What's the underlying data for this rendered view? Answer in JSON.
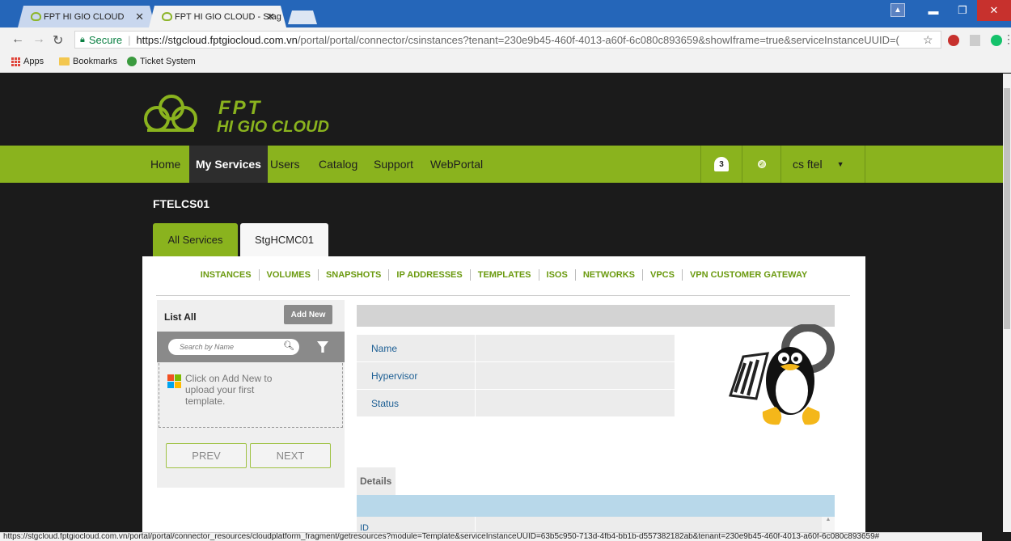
{
  "browser": {
    "tabs": [
      {
        "title": "FPT HI GIO CLOUD",
        "active": false
      },
      {
        "title": "FPT HI GIO CLOUD - Stag",
        "active": true
      }
    ],
    "secure_label": "Secure",
    "url_host": "https://stgcloud.fptgiocloud.com.vn",
    "url_path": "/portal/portal/connector/csinstances?tenant=230e9b45-460f-4013-a60f-6c080c893659&showIframe=true&serviceInstanceUUID=(",
    "bookmarks": [
      "Apps",
      "Bookmarks",
      "Ticket System"
    ],
    "status_url": "https://stgcloud.fptgiocloud.com.vn/portal/portal/connector_resources/cloudplatform_fragment/getresources?module=Template&serviceInstanceUUID=63b5c950-713d-4fb4-bb1b-d557382182ab&tenant=230e9b45-460f-4013-a60f-6c080c893659#"
  },
  "brand": {
    "line1": "FPT",
    "line2": "HI GIO CLOUD",
    "color": "#8ab31e"
  },
  "nav": {
    "items": [
      "Home",
      "My Services",
      "Users",
      "Catalog",
      "Support",
      "WebPortal"
    ],
    "active": "My Services",
    "notification_count": "3",
    "user": "cs ftel"
  },
  "tenant_name": "FTELCS01",
  "tabs": [
    "All Services",
    "StgHCMC01"
  ],
  "subnav": [
    "INSTANCES",
    "VOLUMES",
    "SNAPSHOTS",
    "IP ADDRESSES",
    "TEMPLATES",
    "ISOS",
    "NETWORKS",
    "VPCS",
    "VPN CUSTOMER GATEWAY"
  ],
  "list": {
    "title": "List All",
    "add_label": "Add New",
    "search_placeholder": "Search by Name",
    "empty_text": "Click on Add New to upload your first template.",
    "prev_label": "PREV",
    "next_label": "NEXT"
  },
  "detail": {
    "fields": [
      "Name",
      "Hypervisor",
      "Status"
    ],
    "details_tab": "Details",
    "id_label": "ID"
  }
}
